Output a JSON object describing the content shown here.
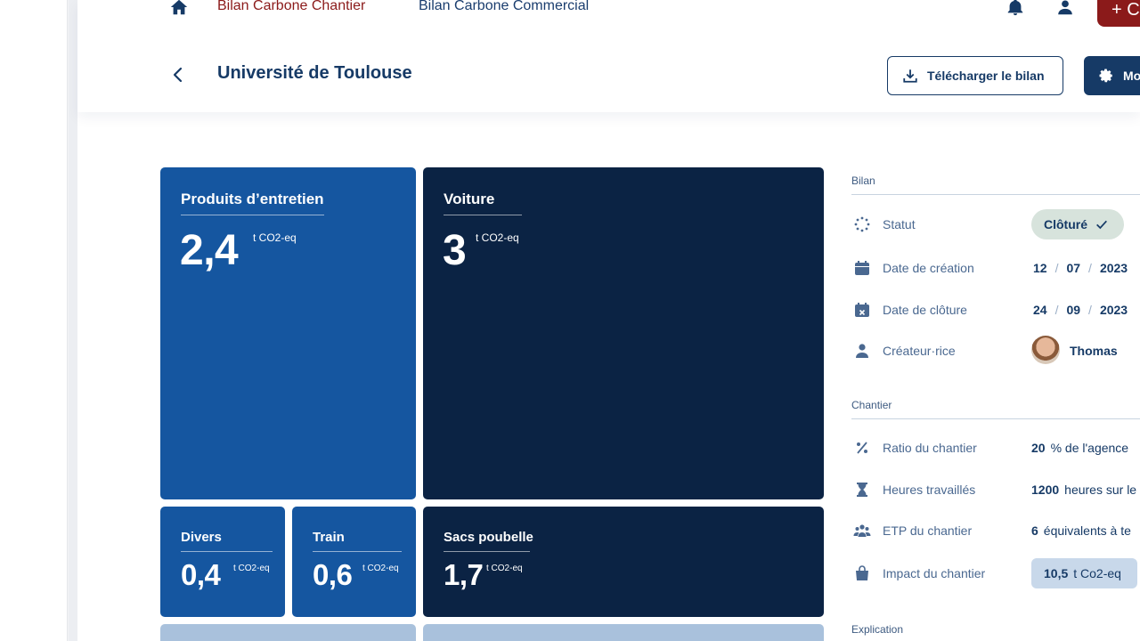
{
  "nav": {
    "tab_active": "Bilan Carbone Chantier",
    "tab_inactive": "Bilan Carbone Commercial",
    "add_label": "+ C"
  },
  "header": {
    "title": "Université de Toulouse",
    "download_label": "Télécharger le bilan",
    "settings_label": "Mo"
  },
  "tiles": [
    {
      "label": "Produits d’entretien",
      "value": "2,4",
      "unit": "t CO2-eq",
      "color": "#1556a0"
    },
    {
      "label": "Voiture",
      "value": "3",
      "unit": "t CO2-eq",
      "color": "#0b2344"
    },
    {
      "label": "Divers",
      "value": "0,4",
      "unit": "t CO2-eq",
      "color": "#1556a0"
    },
    {
      "label": "Train",
      "value": "0,6",
      "unit": "t CO2-eq",
      "color": "#1556a0"
    },
    {
      "label": "Sacs poubelle",
      "value": "1,7",
      "unit": "t CO2-eq",
      "color": "#0b2344"
    }
  ],
  "sidebar": {
    "bilan_heading": "Bilan",
    "statut_label": "Statut",
    "statut_value": "Clôturé",
    "creation_label": "Date de création",
    "creation_date": {
      "d": "12",
      "m": "07",
      "y": "2023"
    },
    "cloture_label": "Date de clôture",
    "cloture_date": {
      "d": "24",
      "m": "09",
      "y": "2023"
    },
    "date_sep": "/",
    "creator_label": "Créateur·rice",
    "creator_name": "Thomas",
    "chantier_heading": "Chantier",
    "ratio_label": "Ratio du chantier",
    "ratio_value": "20",
    "ratio_unit": "% de l'agence",
    "hours_label": "Heures travaillés",
    "hours_value": "1200",
    "hours_unit": "heures sur le",
    "etp_label": "ETP du chantier",
    "etp_value": "6",
    "etp_unit": "équivalents à te",
    "impact_label": "Impact du chantier",
    "impact_value": "10,5",
    "impact_unit": "t Co2-eq",
    "explication_heading": "Explication"
  }
}
